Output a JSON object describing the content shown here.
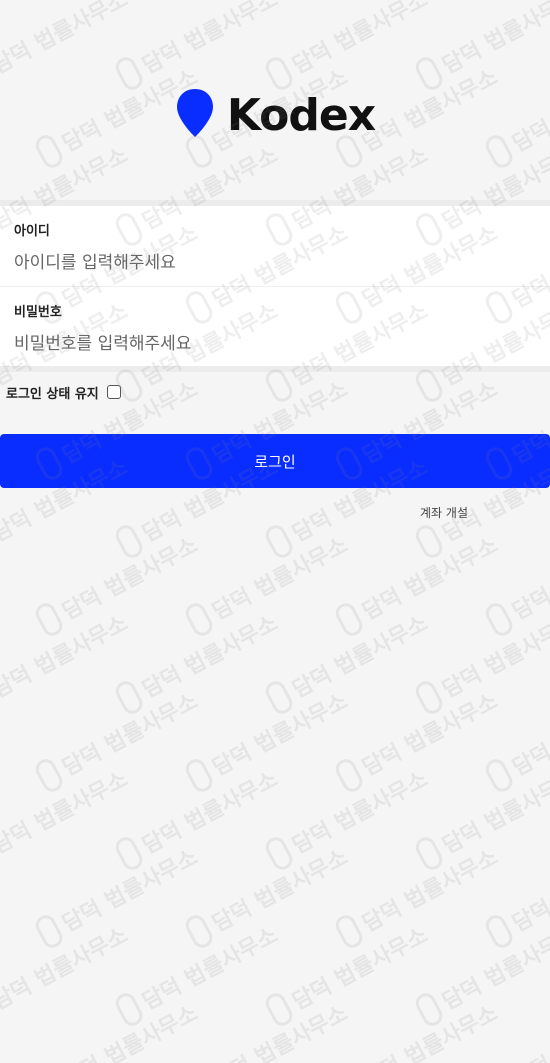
{
  "brand": {
    "name": "Kodex",
    "pin_color": "#0a2dff"
  },
  "form": {
    "id_label": "아이디",
    "id_placeholder": "아이디를 입력해주세요",
    "pw_label": "비밀번호",
    "pw_placeholder": "비밀번호를 입력해주세요",
    "keep_login_label": "로그인 상태 유지",
    "submit_label": "로그인",
    "signup_label": "계좌 개설"
  },
  "watermark": {
    "text": "담덕 법률사무소"
  },
  "colors": {
    "accent": "#0a2dff",
    "background": "#f5f5f5"
  }
}
